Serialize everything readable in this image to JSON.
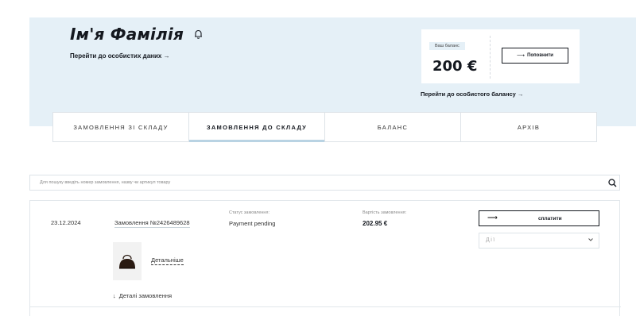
{
  "profile": {
    "name": "Ім'я Фамілія",
    "personal_link": "Перейти до особистих даних →"
  },
  "balance": {
    "badge": "Ваш баланс",
    "amount": "200 €",
    "topup_label": "Поповнити",
    "personal_balance_link": "Перейти до особистого балансу →"
  },
  "tabs": [
    {
      "label": "ЗАМОВЛЕННЯ ЗІ СКЛАДУ",
      "active": false
    },
    {
      "label": "ЗАМОВЛЕННЯ ДО СКЛАДУ",
      "active": true
    },
    {
      "label": "БАЛАНС",
      "active": false
    },
    {
      "label": "АРХІВ",
      "active": false
    }
  ],
  "search": {
    "placeholder": "Для пошуку введіть номер замовлення, назву чи артикул товару"
  },
  "order": {
    "date": "23.12.2024",
    "number": "Замовлення №2426489628",
    "status_label": "Статус замовлення:",
    "status_value": "Payment pending",
    "cost_label": "Вартість замовлення:",
    "cost_value": "202.95 €",
    "pay_label": "сплатити",
    "actions_value": "Дії",
    "details_link": "Детальніше",
    "details_toggle": "Деталі замовлення"
  },
  "icons": {
    "bell": "bell-icon",
    "search": "search-icon",
    "arrow_right": "arrow-right-icon",
    "arrow_down": "arrow-down-icon",
    "chevron_down": "chevron-down-icon"
  },
  "colors": {
    "hero_bg": "#e5f0f7",
    "text_dark": "#14181f",
    "active_tab_underline": "#b9d3e3",
    "border": "#dde3e8"
  }
}
